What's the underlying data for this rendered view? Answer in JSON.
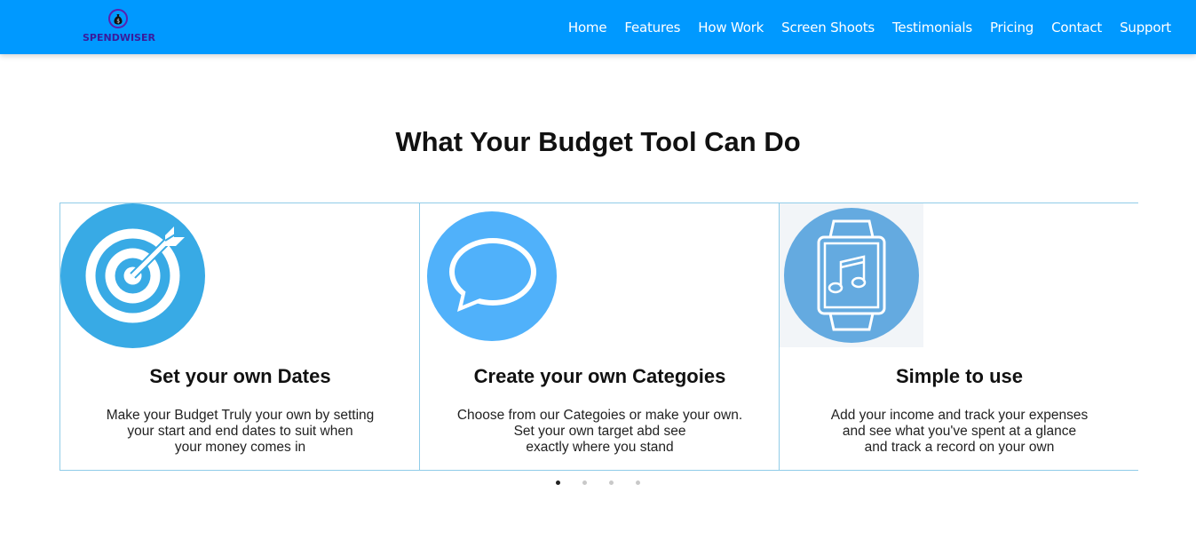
{
  "brand": {
    "name": "SPENDWISER",
    "icon": "money-bag-icon"
  },
  "nav": {
    "items": [
      {
        "label": "Home"
      },
      {
        "label": "Features"
      },
      {
        "label": "How Work"
      },
      {
        "label": "Screen Shoots"
      },
      {
        "label": "Testimonials"
      },
      {
        "label": "Pricing"
      },
      {
        "label": "Contact"
      },
      {
        "label": "Support"
      }
    ]
  },
  "section": {
    "title": "What Your Budget Tool Can Do"
  },
  "cards": [
    {
      "icon": "target-icon",
      "title": "Set your own Dates",
      "lines": [
        "Make your Budget Truly your own by setting",
        "your start and end dates to suit when",
        "your money comes in"
      ]
    },
    {
      "icon": "speech-bubble-icon",
      "title": "Create your own Categoies",
      "lines": [
        "Choose from our Categoies or make your own.",
        "Set your own target abd see",
        "exactly where you stand"
      ]
    },
    {
      "icon": "smartwatch-music-icon",
      "title": "Simple to use",
      "lines": [
        "Add your income and track your expenses",
        "and see what you've spent at a glance",
        "and track a record on your own"
      ]
    }
  ],
  "carousel": {
    "dot_count": 4,
    "active_dot": 1
  },
  "colors": {
    "navbar": "#0099ff",
    "card_border": "#90cce8",
    "brand_text": "#3a1b9c"
  }
}
